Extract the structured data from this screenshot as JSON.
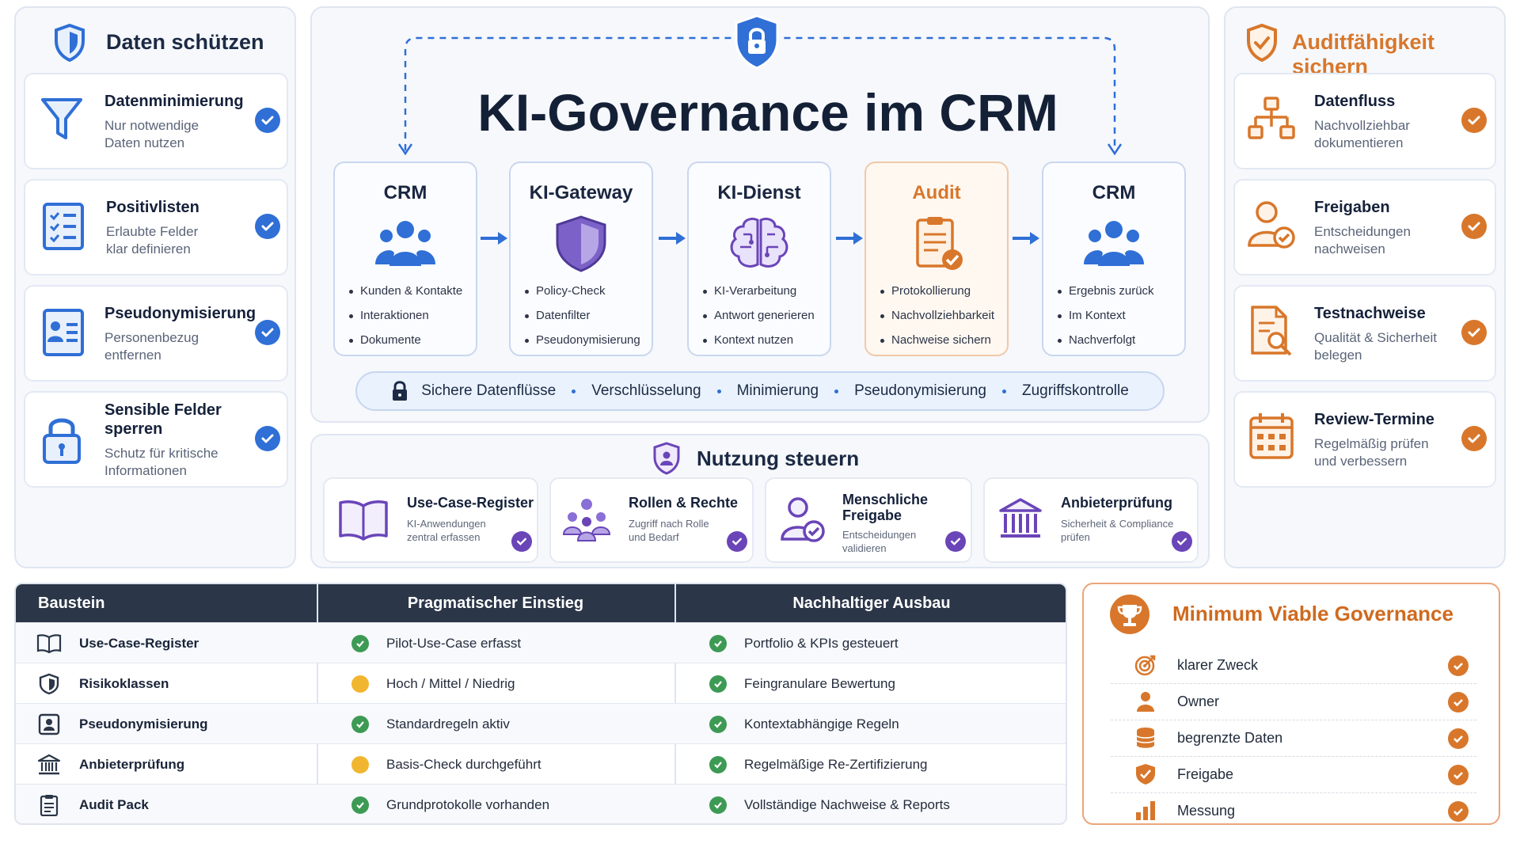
{
  "left": {
    "title": "Daten schützen",
    "items": [
      {
        "title": "Datenminimierung",
        "sub": "Nur notwendige\nDaten nutzen",
        "icon": "funnel-icon"
      },
      {
        "title": "Positivlisten",
        "sub": "Erlaubte Felder\nklar definieren",
        "icon": "checklist-icon"
      },
      {
        "title": "Pseudonymisierung",
        "sub": "Personenbezug\nentfernen",
        "icon": "id-card-icon"
      },
      {
        "title": "Sensible Felder\nsperren",
        "sub": "Schutz für kritische\nInformationen",
        "icon": "padlock-icon"
      }
    ]
  },
  "right": {
    "title": "Auditfähigkeit sichern",
    "items": [
      {
        "title": "Datenfluss",
        "sub": "Nachvollziehbar\ndokumentieren",
        "icon": "flowchart-icon"
      },
      {
        "title": "Freigaben",
        "sub": "Entscheidungen\nnachweisen",
        "icon": "user-check-icon"
      },
      {
        "title": "Testnachweise",
        "sub": "Qualität & Sicherheit\nbelegen",
        "icon": "document-search-icon"
      },
      {
        "title": "Review-Termine",
        "sub": "Regelmäßig prüfen\nund verbessern",
        "icon": "calendar-icon"
      }
    ]
  },
  "center": {
    "title": "KI-Governance im CRM",
    "flow": [
      {
        "title": "CRM",
        "bullets": [
          "Kunden & Kontakte",
          "Interaktionen",
          "Dokumente"
        ],
        "icon": "people-icon"
      },
      {
        "title": "KI-Gateway",
        "bullets": [
          "Policy-Check",
          "Datenfilter",
          "Pseudonymisierung"
        ],
        "icon": "shield-icon"
      },
      {
        "title": "KI-Dienst",
        "bullets": [
          "KI-Verarbeitung",
          "Antwort generieren",
          "Kontext nutzen"
        ],
        "icon": "brain-icon"
      },
      {
        "title": "Audit",
        "bullets": [
          "Protokollierung",
          "Nachvollziehbarkeit",
          "Nachweise sichern"
        ],
        "icon": "clipboard-check-icon"
      },
      {
        "title": "CRM",
        "bullets": [
          "Ergebnis zurück",
          "Im Kontext",
          "Nachverfolgt"
        ],
        "icon": "people-icon"
      }
    ],
    "strip": [
      "Sichere Datenflüsse",
      "Verschlüsselung",
      "Minimierung",
      "Pseudonymisierung",
      "Zugriffskontrolle"
    ]
  },
  "nutzung": {
    "title": "Nutzung steuern",
    "items": [
      {
        "title": "Use-Case-Register",
        "sub": "KI-Anwendungen\nzentral erfassen",
        "icon": "book-icon"
      },
      {
        "title": "Rollen & Rechte",
        "sub": "Zugriff nach Rolle\nund Bedarf",
        "icon": "team-icon"
      },
      {
        "title": "Menschliche\nFreigabe",
        "sub": "Entscheidungen\nvalidieren",
        "icon": "user-approve-icon"
      },
      {
        "title": "Anbieterprüfung",
        "sub": "Sicherheit & Compliance\nprüfen",
        "icon": "bank-icon"
      }
    ]
  },
  "table": {
    "headers": [
      "Baustein",
      "Pragmatischer Einstieg",
      "Nachhaltiger Ausbau"
    ],
    "rows": [
      {
        "name": "Use-Case-Register",
        "icon": "book-icon",
        "start": "Pilot-Use-Case erfasst",
        "start_status": "green",
        "growth": "Portfolio & KPIs gesteuert",
        "growth_status": "green"
      },
      {
        "name": "Risikoklassen",
        "icon": "shield-icon",
        "start": "Hoch / Mittel / Niedrig",
        "start_status": "yellow",
        "growth": "Feingranulare Bewertung",
        "growth_status": "green"
      },
      {
        "name": "Pseudonymisierung",
        "icon": "id-card-icon",
        "start": "Standardregeln aktiv",
        "start_status": "green",
        "growth": "Kontextabhängige Regeln",
        "growth_status": "green"
      },
      {
        "name": "Anbieterprüfung",
        "icon": "bank-icon",
        "start": "Basis-Check durchgeführt",
        "start_status": "yellow",
        "growth": "Regelmäßige Re-Zertifizierung",
        "growth_status": "green"
      },
      {
        "name": "Audit Pack",
        "icon": "clipboard-icon",
        "start": "Grundprotokolle vorhanden",
        "start_status": "green",
        "growth": "Vollständige Nachweise & Reports",
        "growth_status": "green"
      }
    ]
  },
  "mvg": {
    "title": "Minimum Viable Governance",
    "items": [
      {
        "label": "klarer Zweck",
        "icon": "target-icon"
      },
      {
        "label": "Owner",
        "icon": "person-icon"
      },
      {
        "label": "begrenzte Daten",
        "icon": "database-icon"
      },
      {
        "label": "Freigabe",
        "icon": "shield-check-icon"
      },
      {
        "label": "Messung",
        "icon": "bar-chart-icon"
      }
    ]
  },
  "colors": {
    "blue": "#2f6fd6",
    "orange": "#d8772b",
    "purple": "#6a45b8",
    "green": "#3d9a54",
    "yellow": "#f1b630",
    "navy": "#2b3648"
  }
}
